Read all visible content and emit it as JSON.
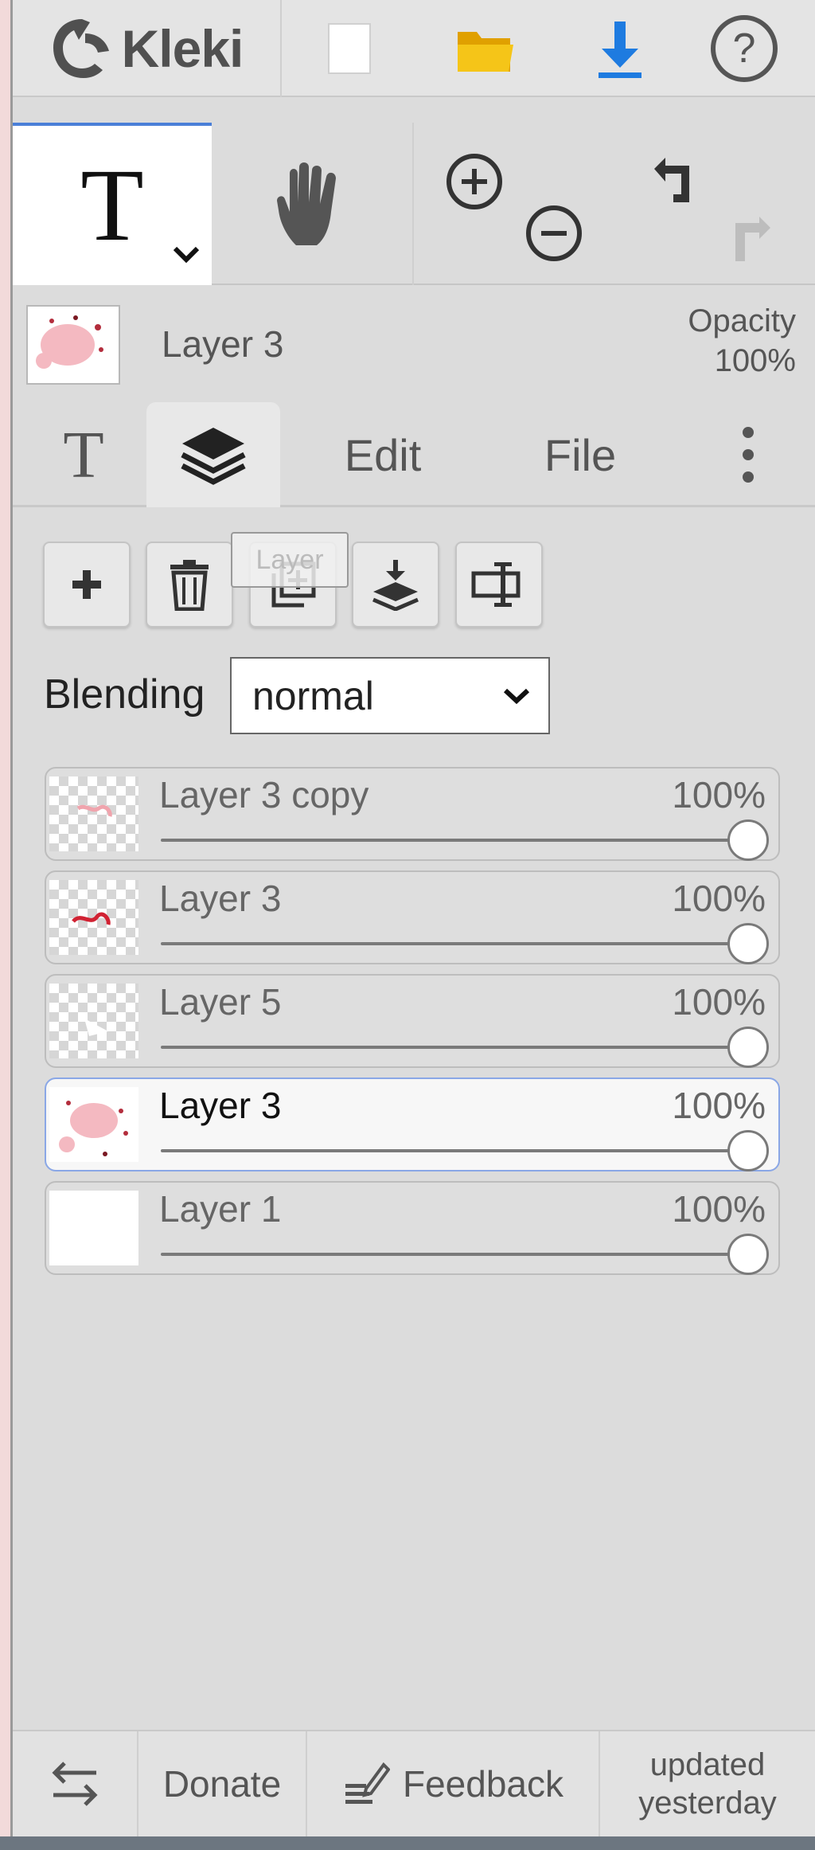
{
  "app": {
    "logo_text": "Kleki"
  },
  "top_icons": [
    "new-file-icon",
    "open-folder-icon",
    "download-icon",
    "help-icon"
  ],
  "tools": {
    "active_tool": "text",
    "zoom": [
      "zoom-in-icon",
      "zoom-out-icon"
    ],
    "history": [
      "undo-icon",
      "redo-icon"
    ]
  },
  "current_layer": {
    "name": "Layer 3",
    "opacity_label": "Opacity",
    "opacity_value": "100%"
  },
  "tabs": [
    {
      "label": "",
      "icon": "text-tool-icon"
    },
    {
      "label": "",
      "icon": "layers-icon",
      "active": true
    },
    {
      "label": "Edit"
    },
    {
      "label": "File"
    },
    {
      "label": "",
      "icon": "more-vertical-icon"
    }
  ],
  "layer_actions": {
    "buttons": [
      "add-layer-icon",
      "delete-layer-icon",
      "duplicate-layer-icon",
      "merge-down-icon",
      "rename-layer-icon"
    ],
    "tooltip": "Layer"
  },
  "blending": {
    "label": "Blending",
    "value": "normal"
  },
  "layers": [
    {
      "name": "Layer 3 copy",
      "opacity": "100%",
      "opacity_value": 1.0,
      "selected": false,
      "thumb": "transparent-doodle"
    },
    {
      "name": "Layer 3",
      "opacity": "100%",
      "opacity_value": 1.0,
      "selected": false,
      "thumb": "transparent-doodle"
    },
    {
      "name": "Layer 5",
      "opacity": "100%",
      "opacity_value": 1.0,
      "selected": false,
      "thumb": "transparent"
    },
    {
      "name": "Layer 3",
      "opacity": "100%",
      "opacity_value": 1.0,
      "selected": true,
      "thumb": "pink-blob"
    },
    {
      "name": "Layer 1",
      "opacity": "100%",
      "opacity_value": 1.0,
      "selected": false,
      "thumb": "white"
    }
  ],
  "footer": {
    "swap_icon": "swap-arrows-icon",
    "donate": "Donate",
    "feedback": "Feedback",
    "updated_line1": "updated",
    "updated_line2": "yesterday"
  },
  "colors": {
    "accent_blue": "#4a7fd8",
    "download_blue": "#1e7be0",
    "folder_yellow": "#f5b400",
    "panel_bg": "#dcdcdc"
  }
}
